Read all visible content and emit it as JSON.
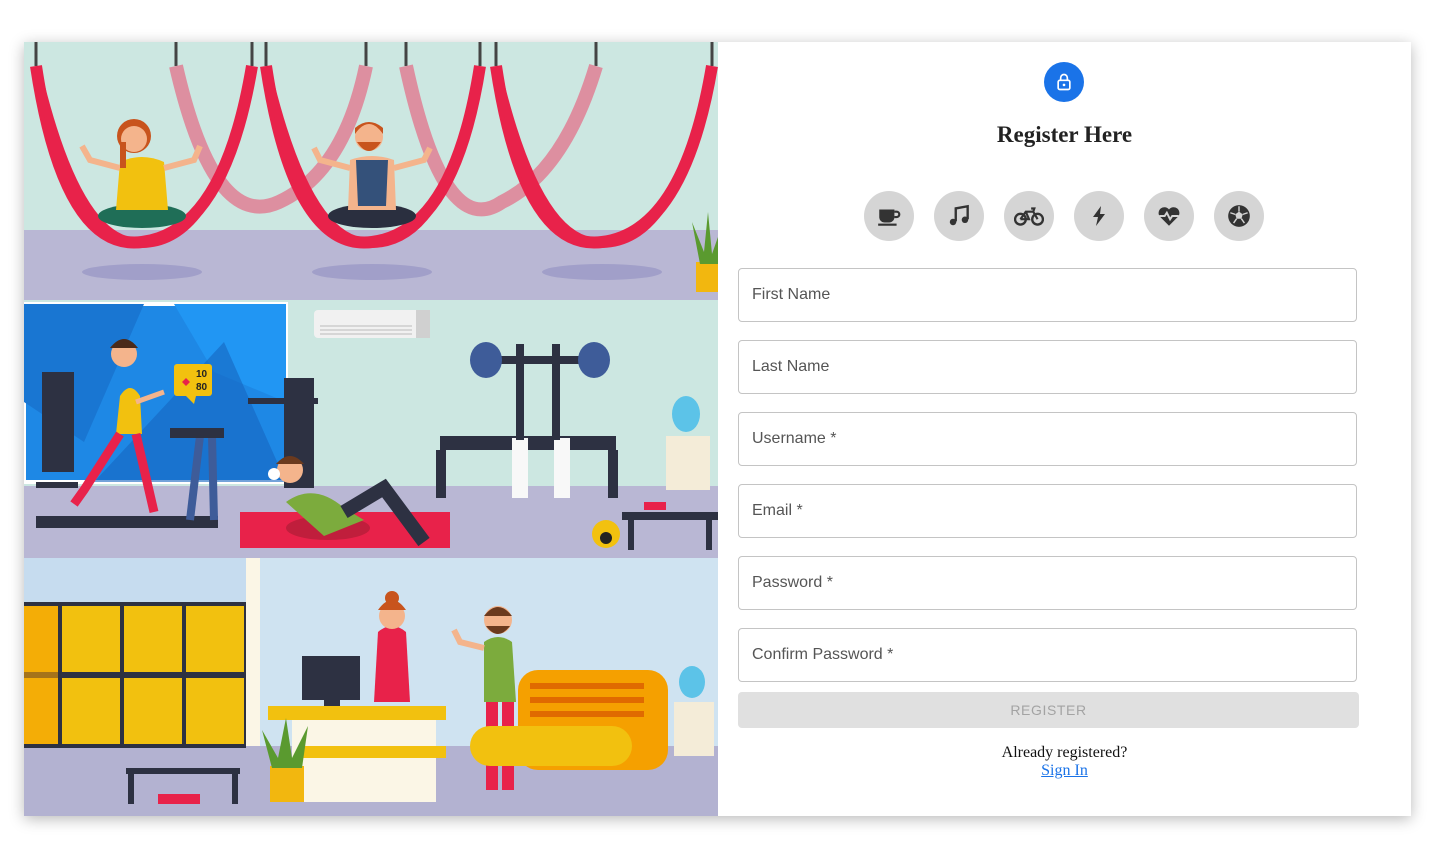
{
  "register": {
    "title": "Register Here",
    "lock_icon": "lock-icon",
    "category_icons": [
      "coffee-icon",
      "music-icon",
      "bicycle-icon",
      "lightning-icon",
      "heartbeat-icon",
      "soccer-ball-icon"
    ],
    "fields": [
      {
        "label": "First Name",
        "required": false
      },
      {
        "label": "Last Name",
        "required": false
      },
      {
        "label": "Username",
        "required": true
      },
      {
        "label": "Email",
        "required": true
      },
      {
        "label": "Password",
        "required": true
      },
      {
        "label": "Confirm Password",
        "required": true
      }
    ],
    "field_labels": {
      "first_name": "First Name",
      "last_name": "Last Name",
      "username": "Username *",
      "email": "Email *",
      "password": "Password *",
      "confirm_password": "Confirm Password *"
    },
    "button_label": "REGISTER",
    "already_text": "Already registered?",
    "signin_label": "Sign In"
  },
  "illustration": {
    "tracker_steps": "10",
    "tracker_heart": "80"
  },
  "colors": {
    "accent": "#1a73e8",
    "icon_bg": "#d5d5d5",
    "button_disabled": "#e0e0e0",
    "hammock": "#e8224a"
  }
}
